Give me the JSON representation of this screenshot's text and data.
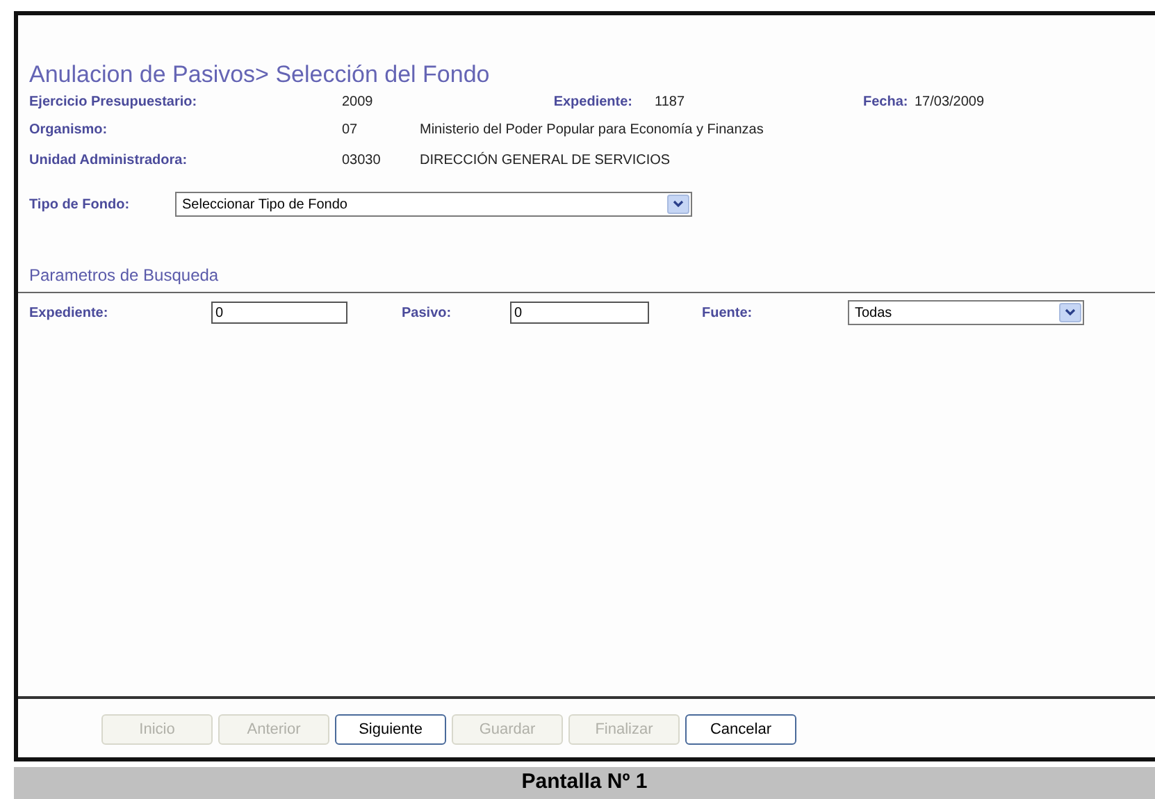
{
  "header": {
    "title": "Anulacion de Pasivos> Selección del Fondo"
  },
  "info": [
    {
      "label": "Ejercicio Presupuestario:",
      "value": "2009",
      "extra_label": "Expediente:",
      "extra_value": "1187",
      "date_label": "Fecha:",
      "date_value": "17/03/2009"
    },
    {
      "label": "Organismo:",
      "value": "07",
      "description": "Ministerio del Poder Popular para Economía y Finanzas"
    },
    {
      "label": "Unidad Administradora:",
      "value": "03030",
      "description": "DIRECCIÓN GENERAL DE SERVICIOS"
    }
  ],
  "tipo_fondo": {
    "label": "Tipo de Fondo:",
    "value": "Seleccionar Tipo de Fondo"
  },
  "search": {
    "heading": "Parametros de Busqueda",
    "expediente": {
      "label": "Expediente:",
      "value": "0"
    },
    "pasivo": {
      "label": "Pasivo:",
      "value": "0"
    },
    "fuente": {
      "label": "Fuente:",
      "value": "Todas"
    }
  },
  "buttons": [
    {
      "label": "Inicio",
      "disabled": true
    },
    {
      "label": "Anterior",
      "disabled": true
    },
    {
      "label": "Siguiente",
      "disabled": false
    },
    {
      "label": "Guardar",
      "disabled": true
    },
    {
      "label": "Finalizar",
      "disabled": true
    },
    {
      "label": "Cancelar",
      "disabled": false
    }
  ],
  "caption": "Pantalla Nº 1"
}
